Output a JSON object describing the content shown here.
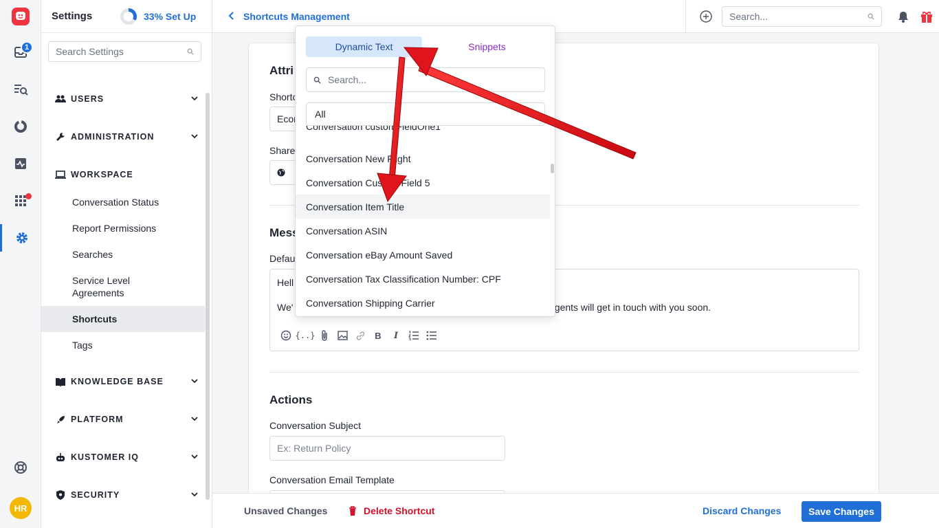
{
  "rail": {
    "inbox_badge": "1",
    "avatar_initials": "HR"
  },
  "sidebar": {
    "title": "Settings",
    "setup_progress": 0.33,
    "setup_label": "33% Set Up",
    "search_placeholder": "Search Settings",
    "sections": [
      {
        "label": "USERS"
      },
      {
        "label": "ADMINISTRATION"
      },
      {
        "label": "WORKSPACE"
      },
      {
        "label": "KNOWLEDGE BASE"
      },
      {
        "label": "PLATFORM"
      },
      {
        "label": "KUSTOMER IQ"
      },
      {
        "label": "SECURITY"
      }
    ],
    "workspace_items": [
      {
        "label": "Conversation Status"
      },
      {
        "label": "Report Permissions"
      },
      {
        "label": "Searches"
      },
      {
        "label": "Service Level Agreements"
      },
      {
        "label": "Shortcuts"
      },
      {
        "label": "Tags"
      }
    ]
  },
  "header": {
    "breadcrumb": "Shortcuts Management",
    "search_placeholder": "Search..."
  },
  "form": {
    "attributes_heading": "Attri",
    "shortcut_label": "Shortc",
    "shortcut_value": "Econ",
    "sharing_label": "Share",
    "message_heading": "Mess",
    "default_label": "Defau",
    "editor_line1": "Hell",
    "editor_line2_start": "We'",
    "editor_line2_end": "agents will get in touch with you soon.",
    "actions_heading": "Actions",
    "subject_label": "Conversation Subject",
    "subject_placeholder": "Ex: Return Policy",
    "email_template_label": "Conversation Email Template"
  },
  "footer": {
    "unsaved": "Unsaved Changes",
    "delete": "Delete Shortcut",
    "discard": "Discard Changes",
    "save": "Save Changes"
  },
  "popup": {
    "tab_dynamic": "Dynamic Text",
    "tab_snippets": "Snippets",
    "search_placeholder": "Search...",
    "filter_value": "All",
    "items": [
      "Conversation customFieldOne1",
      "Conversation New Flight",
      "Conversation Custom Field 5",
      "Conversation Item Title",
      "Conversation ASIN",
      "Conversation eBay Amount Saved",
      "Conversation Tax Classification Number: CPF",
      "Conversation Shipping Carrier"
    ]
  },
  "colors": {
    "accent": "#1f6fd6",
    "danger": "#d0112b",
    "annotation_arrow": "#e0141c"
  }
}
